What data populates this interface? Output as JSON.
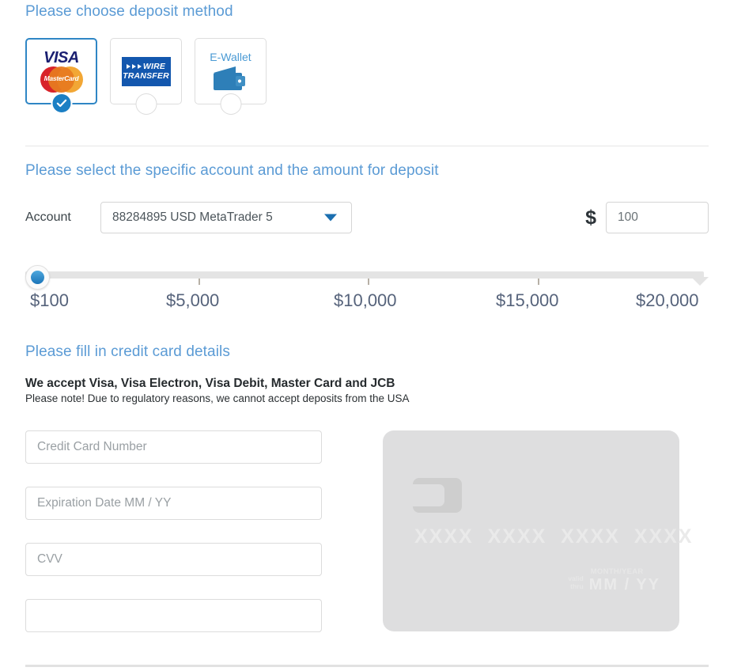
{
  "deposit_method": {
    "heading": "Please choose deposit method",
    "methods": [
      {
        "id": "credit-card",
        "name": "visa-mastercard",
        "visa_label": "VISA",
        "mastercard_label": "MasterCard",
        "selected": true
      },
      {
        "id": "wire-transfer",
        "name": "wire-transfer",
        "line1": "WIRE",
        "line2": "TRANSFER",
        "selected": false
      },
      {
        "id": "e-wallet",
        "name": "e-wallet",
        "label": "E-Wallet",
        "selected": false
      }
    ]
  },
  "account_section": {
    "heading": "Please select the specific account and the amount for deposit",
    "account_label": "Account",
    "account_selected": "88284895 USD MetaTrader 5",
    "account_options": [
      "88284895 USD MetaTrader 5"
    ],
    "currency_symbol": "$",
    "amount_value": "100",
    "amount_placeholder": "100"
  },
  "slider": {
    "min_label": "$100",
    "max_label": "$20,000",
    "value": 100,
    "min": 100,
    "max": 20000,
    "ticks": [
      "$100",
      "$5,000",
      "$10,000",
      "$15,000",
      "$20,000"
    ]
  },
  "card_section": {
    "heading": "Please fill in credit card details",
    "accept_line": "We accept Visa, Visa Electron, Visa Debit, Master Card and JCB",
    "note_line": "Please note! Due to regulatory reasons, we cannot accept deposits from the USA",
    "fields": [
      {
        "name": "credit-card-number",
        "placeholder": "Credit Card Number",
        "value": ""
      },
      {
        "name": "expiration-date",
        "placeholder": "Expiration Date MM / YY",
        "value": ""
      },
      {
        "name": "cvv",
        "placeholder": "CVV",
        "value": ""
      },
      {
        "name": "cardholder-name",
        "placeholder": "",
        "value": ""
      }
    ],
    "preview": {
      "number_placeholder": "XXXX  XXXX  XXXX  XXXX",
      "valid_line1": "valid",
      "valid_line2": "thru",
      "month_year_label": "MONTH/YEAR",
      "expiry_placeholder": "MM / YY"
    }
  },
  "colors": {
    "heading_blue": "#5b9bd5",
    "accent_blue": "#1b7fc4",
    "visa_blue": "#1a1f71",
    "wire_blue": "#1357ae",
    "mastercard_red": "#d8232a",
    "mastercard_yellow": "#f2a735",
    "slider_label": "#56637b",
    "card_grey": "#dededf"
  }
}
